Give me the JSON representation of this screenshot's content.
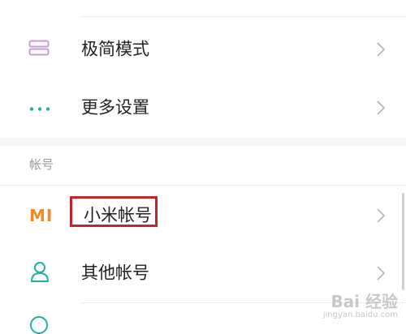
{
  "settings_list": {
    "items": [
      {
        "label": "极简模式",
        "icon": "layout-rows-icon"
      },
      {
        "label": "更多设置",
        "icon": "more-dots-icon"
      }
    ]
  },
  "account_section": {
    "title": "帐号",
    "items": [
      {
        "label": "小米帐号",
        "icon": "mi-logo-icon",
        "logo_text": "MI"
      },
      {
        "label": "其他帐号",
        "icon": "person-icon"
      }
    ]
  },
  "watermark": {
    "brand": "Bai 经验",
    "url": "jingyan.baidu.com"
  },
  "colors": {
    "highlight": "#c8232c",
    "mi_orange": "#f08a24",
    "icon_purple": "#c89be0",
    "icon_teal": "#1fb0a3"
  }
}
